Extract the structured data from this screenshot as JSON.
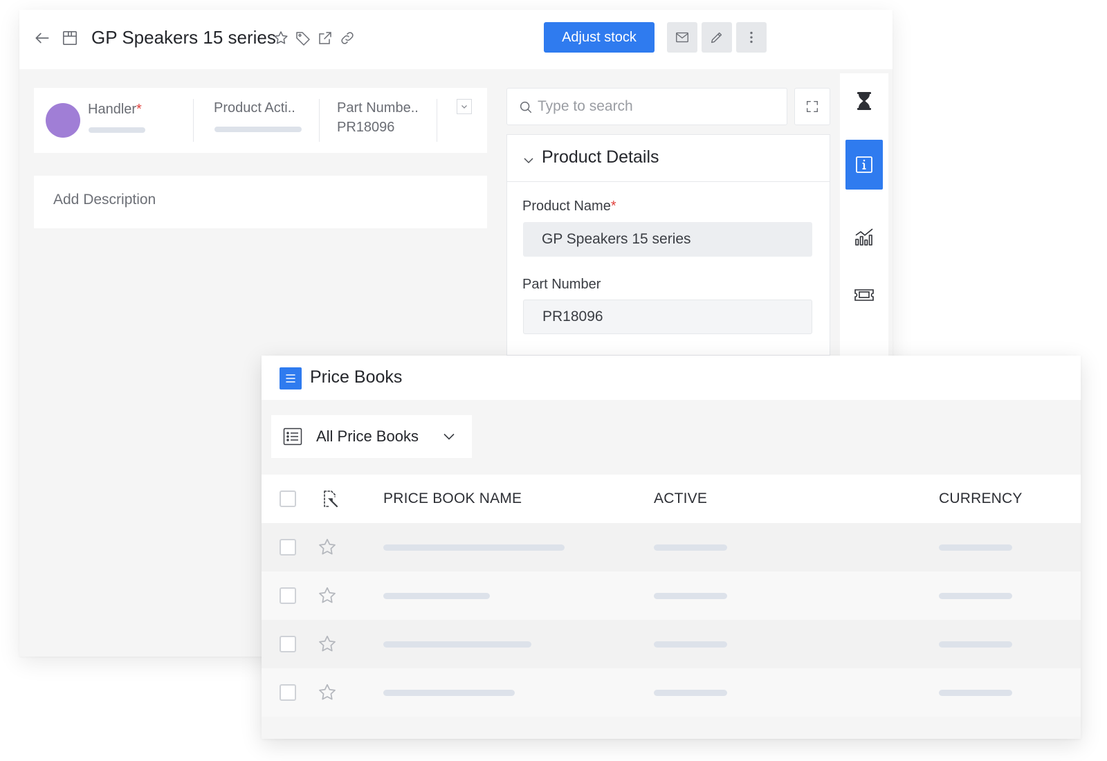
{
  "header": {
    "title": "GP Speakers 15 series",
    "adjust_stock_label": "Adjust stock"
  },
  "summary": {
    "handler_label": "Handler",
    "required_mark": "*",
    "product_active_label": "Product Acti..",
    "part_number_label": "Part Numbe..",
    "part_number_value": "PR18096"
  },
  "description": {
    "placeholder": "Add Description"
  },
  "search": {
    "placeholder": "Type to search"
  },
  "details": {
    "section_title": "Product Details",
    "product_name_label": "Product Name",
    "required_mark": "*",
    "product_name_value": "GP Speakers 15 series",
    "part_number_label": "Part Number",
    "part_number_value": "PR18096"
  },
  "price_books": {
    "title": "Price Books",
    "view_label": "All Price Books",
    "columns": [
      "PRICE BOOK NAME",
      "ACTIVE",
      "CURRENCY"
    ]
  },
  "colors": {
    "accent": "#2f7bef",
    "avatar": "#a07ed6",
    "required": "#e0413d"
  }
}
